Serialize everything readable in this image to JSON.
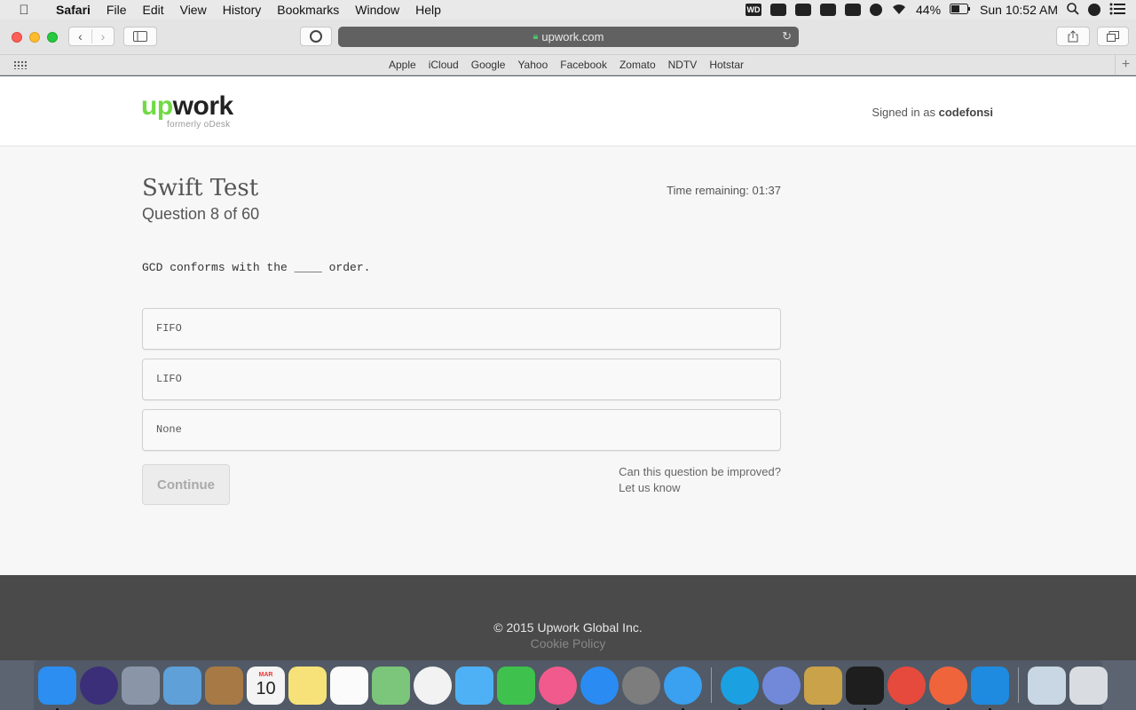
{
  "menubar": {
    "app_name": "Safari",
    "menus": [
      "File",
      "Edit",
      "View",
      "History",
      "Bookmarks",
      "Window",
      "Help"
    ],
    "battery": "44%",
    "clock": "Sun 10:52 AM",
    "wd_label": "WD"
  },
  "browser": {
    "url": "upwork.com",
    "favorites": [
      "Apple",
      "iCloud",
      "Google",
      "Yahoo",
      "Facebook",
      "Zomato",
      "NDTV",
      "Hotstar"
    ]
  },
  "site": {
    "logo_up": "up",
    "logo_work": "work",
    "logo_sub": "formerly oDesk",
    "signed_in_prefix": "Signed in as ",
    "username": "codefonsi"
  },
  "test": {
    "title": "Swift Test",
    "question_count": "Question 8 of 60",
    "time_remaining": "Time remaining: 01:37",
    "question": "GCD conforms with the ____ order.",
    "answers": [
      "FIFO",
      "LIFO",
      "None"
    ],
    "continue_label": "Continue",
    "improve_line1": "Can this question be improved?",
    "improve_line2": "Let us know"
  },
  "footer": {
    "copyright": "© 2015 Upwork Global Inc.",
    "cookie_policy": "Cookie Policy"
  },
  "dock": {
    "apps": [
      {
        "name": "finder-icon",
        "color": "#2b8ef0",
        "running": true
      },
      {
        "name": "siri-icon",
        "color": "#3b2f7a",
        "running": false
      },
      {
        "name": "launchpad-icon",
        "color": "#8a96a8",
        "running": false
      },
      {
        "name": "mail-stamp-icon",
        "color": "#5fa0d8",
        "running": false
      },
      {
        "name": "contacts-icon",
        "color": "#a77a45",
        "running": false
      },
      {
        "name": "calendar-icon",
        "color": "#f4f4f4",
        "running": false
      },
      {
        "name": "notes-icon",
        "color": "#f7e27a",
        "running": false
      },
      {
        "name": "reminders-icon",
        "color": "#fbfbfb",
        "running": false
      },
      {
        "name": "maps-icon",
        "color": "#7bc67a",
        "running": false
      },
      {
        "name": "photos-icon",
        "color": "#f2f2f2",
        "running": false
      },
      {
        "name": "messages-icon",
        "color": "#4fb1f5",
        "running": false
      },
      {
        "name": "facetime-icon",
        "color": "#3ec24d",
        "running": false
      },
      {
        "name": "itunes-icon",
        "color": "#f15a8c",
        "running": true
      },
      {
        "name": "app-store-icon",
        "color": "#2a8bf2",
        "running": false
      },
      {
        "name": "system-preferences-icon",
        "color": "#7d7d7d",
        "running": false
      },
      {
        "name": "safari-icon",
        "color": "#3aa0f0",
        "running": true
      },
      {
        "name": "skype-icon",
        "color": "#1ba1e2",
        "running": true
      },
      {
        "name": "discord-icon",
        "color": "#7289da",
        "running": true
      },
      {
        "name": "keychain-icon",
        "color": "#c9a24a",
        "running": true
      },
      {
        "name": "terminal-icon",
        "color": "#1e1e1e",
        "running": true
      },
      {
        "name": "chrome-icon",
        "color": "#e64a3c",
        "running": true
      },
      {
        "name": "pencil-app-icon",
        "color": "#f0643c",
        "running": true
      },
      {
        "name": "xcode-icon",
        "color": "#1e8be0",
        "running": true
      },
      {
        "name": "downloads-folder-icon",
        "color": "#c9d6e4",
        "running": false
      },
      {
        "name": "trash-icon",
        "color": "#d9dde2",
        "running": false
      }
    ],
    "calendar_month": "MAR",
    "calendar_day": "10"
  }
}
